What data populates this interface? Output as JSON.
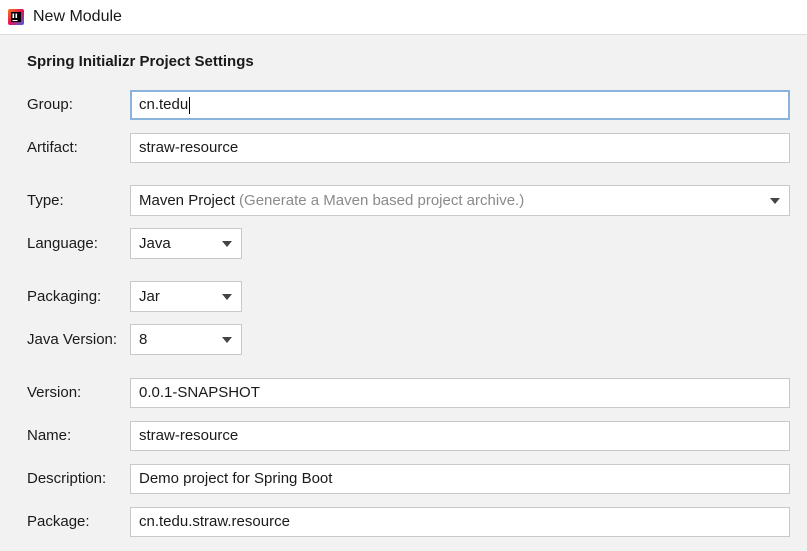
{
  "window": {
    "title": "New Module",
    "icon": "intellij-icon"
  },
  "section_title": "Spring Initializr Project Settings",
  "fields": {
    "group": {
      "label": "Group:",
      "value": "cn.tedu"
    },
    "artifact": {
      "label": "Artifact:",
      "value": "straw-resource"
    },
    "type": {
      "label": "Type:",
      "value": "Maven Project",
      "hint": "(Generate a Maven based project archive.)"
    },
    "language": {
      "label": "Language:",
      "value": "Java"
    },
    "packaging": {
      "label": "Packaging:",
      "value": "Jar"
    },
    "java_version": {
      "label": "Java Version:",
      "value": "8"
    },
    "version": {
      "label": "Version:",
      "value": "0.0.1-SNAPSHOT"
    },
    "name": {
      "label": "Name:",
      "value": "straw-resource"
    },
    "description": {
      "label": "Description:",
      "value": "Demo project for Spring Boot"
    },
    "package": {
      "label": "Package:",
      "value": "cn.tedu.straw.resource"
    }
  },
  "colors": {
    "focus_border": "#8ab4dc",
    "hint_text": "#8a8a8a",
    "field_border": "#c9c9c9"
  }
}
